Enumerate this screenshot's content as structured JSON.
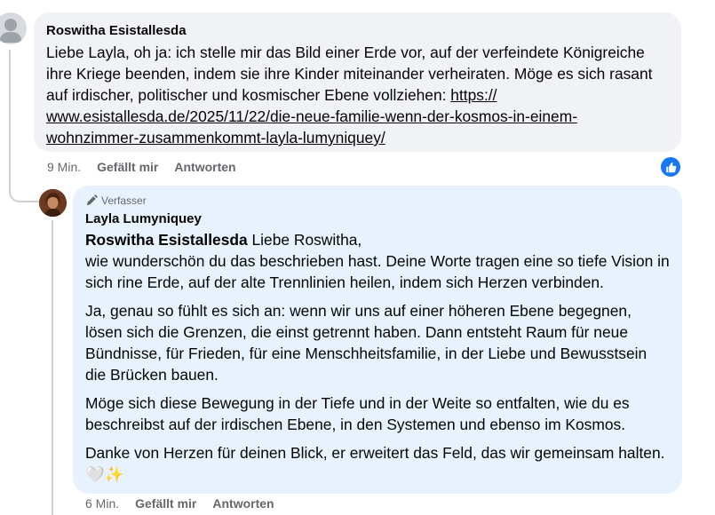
{
  "comment1": {
    "author": "Roswitha Esistallesda",
    "text": "Liebe Layla, oh ja: ich stelle mir das Bild einer Erde vor, auf der verfeindete Königreiche ihre Kriege beenden, indem sie ihre Kinder miteinander verheiraten. Möge es sich rasant auf irdischer, politischer und kosmischer Ebene vollziehen: ",
    "link": "https://www.esistallesda.de/2025/11/22/die-neue-familie-wenn-der-kosmos-in-einem-wohnzimmer-zusammenkommt-layla-lumyniquey/",
    "link_line1": "https://",
    "link_line2": "www.esistallesda.de/2025/11/22/die-neue-familie-wenn-der-kosmos-in-einem-",
    "link_line3": "wohnzimmer-zusammenkommt-layla-lumyniquey/",
    "time": "9 Min.",
    "like_label": "Gefällt mir",
    "reply_label": "Antworten",
    "reaction_icon": "thumbs-up-icon"
  },
  "reply1": {
    "badge": "Verfasser",
    "badge_icon": "pen-icon",
    "author": "Layla Lumyniquey",
    "mention": "Roswitha Esistallesda",
    "p1_after_mention": " Liebe Roswitha,",
    "p1_rest": "wie wunderschön du das beschrieben hast. Deine Worte tragen eine so tiefe Vision in sich rine Erde, auf der alte Trennlinien heilen, indem sich Herzen verbinden.",
    "p2": "Ja, genau so fühlt es sich an: wenn wir uns auf einer höheren Ebene begegnen, lösen sich die Grenzen, die einst getrennt haben. Dann entsteht Raum für neue Bündnisse, für Frieden, für eine Menschheitsfamilie, in der Liebe und Bewusstsein die Brücken bauen.",
    "p3": "Möge sich diese Bewegung in der Tiefe und in der Weite so entfalten, wie du es beschreibst auf der irdischen Ebene, in den Systemen und ebenso im Kosmos.",
    "p4": "Danke von Herzen für deinen Blick, er erweitert das Feld, das wir gemeinsam halten. 🤍✨",
    "time": "6 Min.",
    "like_label": "Gefällt mir",
    "reply_label": "Antworten"
  },
  "colors": {
    "bubble_gray": "#f0f2f5",
    "bubble_blue": "#e8f2fe",
    "meta_text": "#65676b",
    "like_blue": "#1877f2"
  }
}
